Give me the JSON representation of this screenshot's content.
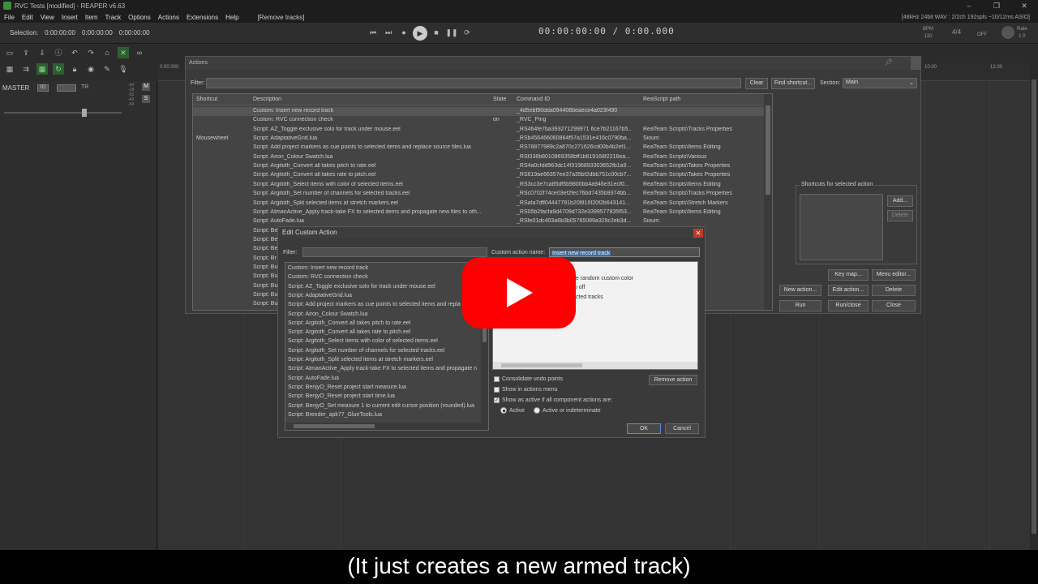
{
  "window": {
    "title": "RVC Tests [modified] - REAPER v6.63",
    "controls": [
      "–",
      "❐",
      "✕"
    ]
  },
  "menu": {
    "items": [
      "File",
      "Edit",
      "View",
      "Insert",
      "Item",
      "Track",
      "Options",
      "Actions",
      "Extensions",
      "Help"
    ],
    "last_action": "[Remove tracks]",
    "audio_status": "[48kHz 24bit WAV : 2/2ch 192spls ~10/12ms ASIO]"
  },
  "transport": {
    "selection_label": "Selection:",
    "selection_start": "0:00:00:00",
    "selection_end": "0:00:00:00",
    "selection_length": "0:00:00:00",
    "clock": "00:00:00:00 / 0:00.000",
    "bpm_label": "BPM",
    "bpm_value": "120",
    "rate_label": "Rate",
    "rate_value": "1.0",
    "off_label": "OFF"
  },
  "master": {
    "label": "MASTER",
    "io_button": "IO",
    "route_label": "TR",
    "db_scale": [
      "-inf",
      "-18",
      "-30",
      "-42",
      "-54"
    ],
    "mute": "M",
    "solo": "S"
  },
  "ruler": {
    "marks": [
      "0:00.000",
      "10.00",
      "12.00"
    ]
  },
  "actions": {
    "title": "Actions",
    "filter_label": "Filter:",
    "clear": "Clear",
    "find_shortcut": "Find shortcut...",
    "section_label": "Section:",
    "section_value": "Main",
    "columns": {
      "shortcut": "Shortcut",
      "description": "Description",
      "state": "State",
      "command_id": "Command ID",
      "path": "ReaScript path"
    },
    "rows": [
      {
        "shortcut": "",
        "description": "Custom: Insert new record track",
        "state": "",
        "command_id": "_4d5ebf90dda094408beaece4a023f490",
        "path": ""
      },
      {
        "shortcut": "",
        "description": "Custom: RVC connection check",
        "state": "on",
        "command_id": "_RVC_Ping",
        "path": ""
      },
      {
        "shortcut": "",
        "description": "Script: AZ_Toggle exclusive solo for track under mouse.eel",
        "state": "",
        "command_id": "_RS464fe7ba393271299971 6ce7b21167b5...",
        "path": "ReaTeam Scripts\\Tracks Properties"
      },
      {
        "shortcut": "Mousewheel",
        "description": "Script: AdaptativeGrid.lua",
        "state": "",
        "command_id": "_RSb456466060864f57a1531e416c0790ba...",
        "path": "Sioum"
      },
      {
        "shortcut": "",
        "description": "Script: Add project markers as cue points to selected items and replace source files.lua",
        "state": "",
        "command_id": "_RS78877989c2a870c271626cd00b4b2ef1...",
        "path": "ReaTeam Scripts\\Items Editing"
      },
      {
        "shortcut": "",
        "description": "Script: Airon_Colour Swatch.lua",
        "state": "",
        "command_id": "_RSf336b8010869358bff1b619168f2216ea...",
        "path": "ReaTeam Scripts\\Various"
      },
      {
        "shortcut": "",
        "description": "Script: Argitoth_Convert all takes pitch to rate.eel",
        "state": "",
        "command_id": "_RS4a0cfdd963dc14f3196893303652fb1a9...",
        "path": "ReaTeam Scripts\\Takes Properties"
      },
      {
        "shortcut": "",
        "description": "Script: Argitoth_Convert all takes rate to pitch.eel",
        "state": "",
        "command_id": "_RS619ae66357ee37a35bf2dbb751c00cb7...",
        "path": "ReaTeam Scripts\\Takes Properties"
      },
      {
        "shortcut": "",
        "description": "Script: Argitoth_Select items with color of selected items.eel",
        "state": "",
        "command_id": "_RS3cc3e7ca85df5b9800bb4a946e31ecf0...",
        "path": "ReaTeam Scripts\\Items Editing"
      },
      {
        "shortcut": "",
        "description": "Script: Argitoth_Set number of channels for selected tracks.eel",
        "state": "",
        "command_id": "_RSc0702f74ce03ef2fec76bd7435b9374bb...",
        "path": "ReaTeam Scripts\\Tracks Properties"
      },
      {
        "shortcut": "",
        "description": "Script: Argitoth_Split selected items at stretch markers.eel",
        "state": "",
        "command_id": "_RSafa7dff04447791b20f816f20f2b643141...",
        "path": "ReaTeam Scripts\\Stretch Markers"
      },
      {
        "shortcut": "",
        "description": "Script: AtmanActive_Apply track-take FX to selected items and propagate new files to oth...",
        "state": "",
        "command_id": "_RS05b2facfa9d4709d732e3399577835f53...",
        "path": "ReaTeam Scripts\\Items Editing"
      },
      {
        "shortcut": "",
        "description": "Script: AutoFade.lua",
        "state": "",
        "command_id": "_RSfe01dc403a6b3b05765089a329c2eb3d...",
        "path": "Sioum"
      },
      {
        "shortcut": "",
        "description": "Script: Be",
        "state": "",
        "command_id": "",
        "path": "Properties"
      },
      {
        "shortcut": "",
        "description": "Script: Be",
        "state": "",
        "command_id": "",
        "path": "Properties"
      },
      {
        "shortcut": "",
        "description": "Script: Be",
        "state": "",
        "command_id": "",
        "path": "Properties"
      },
      {
        "shortcut": "",
        "description": "Script: Br",
        "state": "",
        "command_id": "",
        "path": "Editing"
      },
      {
        "shortcut": "",
        "description": "Script: Bu",
        "state": "",
        "command_id": "",
        "path": ""
      },
      {
        "shortcut": "",
        "description": "Script: Bu",
        "state": "",
        "command_id": "",
        "path": ""
      },
      {
        "shortcut": "",
        "description": "Script: Bu",
        "state": "",
        "command_id": "",
        "path": "Properties"
      },
      {
        "shortcut": "",
        "description": "Script: Bu",
        "state": "",
        "command_id": "",
        "path": "\\buyone_Con..."
      },
      {
        "shortcut": "",
        "description": "Script: Bu",
        "state": "",
        "command_id": "",
        "path": ""
      }
    ],
    "shortcuts_group": "Shortcuts for selected action",
    "add": "Add...",
    "delete_shortcut": "Delete",
    "key_map": "Key map...",
    "menu_editor": "Menu editor...",
    "new_action": "New action...",
    "edit_action": "Edit action...",
    "delete": "Delete",
    "run": "Run",
    "run_close": "Run/close",
    "close": "Close"
  },
  "edit_custom_action": {
    "title": "Edit Custom Action",
    "filter_label": "Filter:",
    "list": [
      "Custom: Insert new record track",
      "Custom: RVC connection check",
      "Script: AZ_Toggle exclusive solo for track under mouse.eel",
      "Script: AdaptativeGrid.lua",
      "Script: Add project markers as cue points to selected items and repla",
      "Script: Airon_Colour Swatch.lua",
      "Script: Argitoth_Convert all takes pitch to rate.eel",
      "Script: Argitoth_Convert all takes rate to pitch.eel",
      "Script: Argitoth_Select items with color of selected items.eel",
      "Script: Argitoth_Set number of channels for selected tracks.eel",
      "Script: Argitoth_Split selected items at stretch markers.eel",
      "Script: AtmanActive_Apply track-take FX to selected items and propagate n",
      "Script: AutoFade.lua",
      "Script: BenjyO_Reset project start measure.lua",
      "Script: BenjyO_Reset project start time.lua",
      "Script: BenjyO_Set measure 1 to current edit cursor position (rounded).lua",
      "Script: Breeder_apk77_GlueTools.lua"
    ],
    "name_label": "Custom action name:",
    "name_value": "Insert new record track",
    "component_actions": [
      "ne random custom color",
      "to off",
      "ected tracks"
    ],
    "consolidate_undo": "Consolidate undo points",
    "show_in_menu": "Show in actions menu",
    "show_active": "Show as active if all component actions are:",
    "active": "Active",
    "active_or_indeterminate": "Active or indeterminate",
    "remove_action": "Remove action",
    "ok": "OK",
    "cancel": "Cancel"
  },
  "caption": "(It just creates a new armed track)",
  "colors": {
    "youtube_red": "#ff0000",
    "close_red": "#c0392b",
    "green_toggle": "#2f5e33"
  }
}
